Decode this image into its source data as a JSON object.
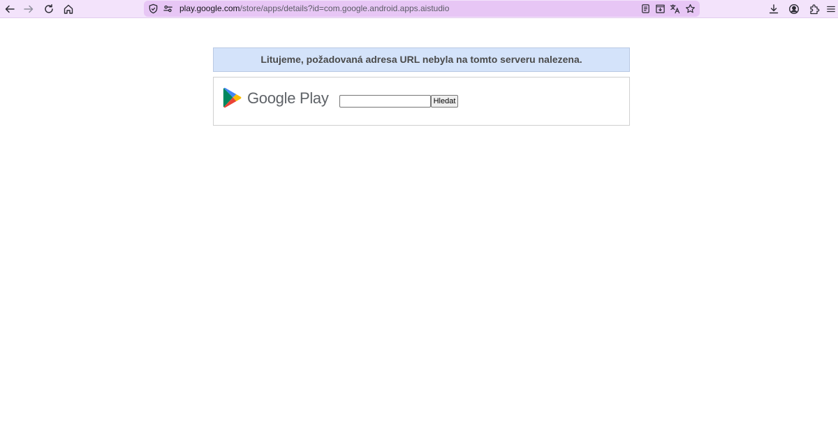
{
  "browser": {
    "url_host": "play.google.com",
    "url_path": "/store/apps/details?id=com.google.android.apps.aistudio",
    "toolbar_icons": {
      "back": "back-arrow-icon",
      "forward": "forward-arrow-icon",
      "reload": "reload-icon",
      "home": "home-icon",
      "tracking_protection": "shield-icon",
      "permissions": "permissions-icon",
      "reader_view": "reader-view-icon",
      "save_to_pocket": "save-download-icon",
      "translate": "translate-icon",
      "bookmark": "star-icon",
      "downloads": "download-icon",
      "account": "account-icon",
      "extensions": "extensions-icon",
      "menu": "menu-icon"
    },
    "theme_colors": {
      "toolbar_bg": "#f3e3fb",
      "urlbar_bg": "#e7c6f5"
    }
  },
  "page": {
    "error_message": "Litujeme, požadovaná adresa URL nebyla na tomto serveru nalezena.",
    "brand_name": "Google Play",
    "search": {
      "value": "",
      "placeholder": "",
      "button_label": "Hledat"
    },
    "colors": {
      "error_bg": "#d4e3fa",
      "logo_green": "#01875f",
      "logo_blue": "#4285f4",
      "logo_yellow": "#fbbc04",
      "logo_red": "#ea4335"
    }
  }
}
